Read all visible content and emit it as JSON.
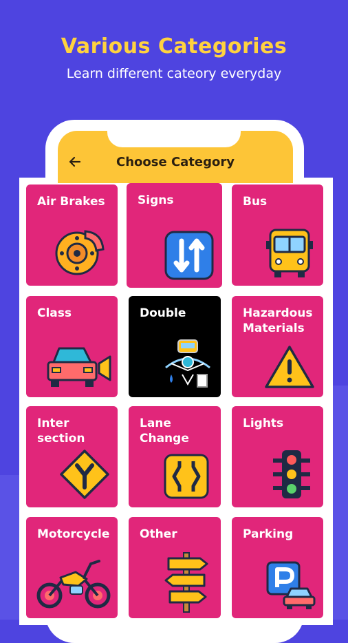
{
  "promo": {
    "headline": "Various Categories",
    "subline": "Learn different cateory everyday"
  },
  "app_bar": {
    "back_icon": "arrow-left-icon",
    "title": "Choose Category"
  },
  "categories": [
    {
      "label": "Air Brakes",
      "icon": "brake-disc-icon"
    },
    {
      "label": "Signs",
      "icon": "two-way-arrows-sign-icon"
    },
    {
      "label": "Bus",
      "icon": "bus-icon"
    },
    {
      "label": "Class",
      "icon": "car-rear-icon"
    },
    {
      "label": "Double",
      "icon": "tow-trailer-icon"
    },
    {
      "label": "Hazardous\nMaterials",
      "icon": "warning-triangle-icon"
    },
    {
      "label": "Inter\nsection",
      "icon": "intersection-sign-icon"
    },
    {
      "label": "Lane\nChange",
      "icon": "lane-change-sign-icon"
    },
    {
      "label": "Lights",
      "icon": "traffic-light-icon"
    },
    {
      "label": "Motorcycle",
      "icon": "motorcycle-icon"
    },
    {
      "label": "Other",
      "icon": "signpost-icon"
    },
    {
      "label": "Parking",
      "icon": "parking-sign-icon"
    }
  ],
  "colors": {
    "background": "#4e44e0",
    "headline": "#ffd23f",
    "app_bar": "#fdc537",
    "tile": "#e1267a",
    "tile_selected": "#000000"
  }
}
